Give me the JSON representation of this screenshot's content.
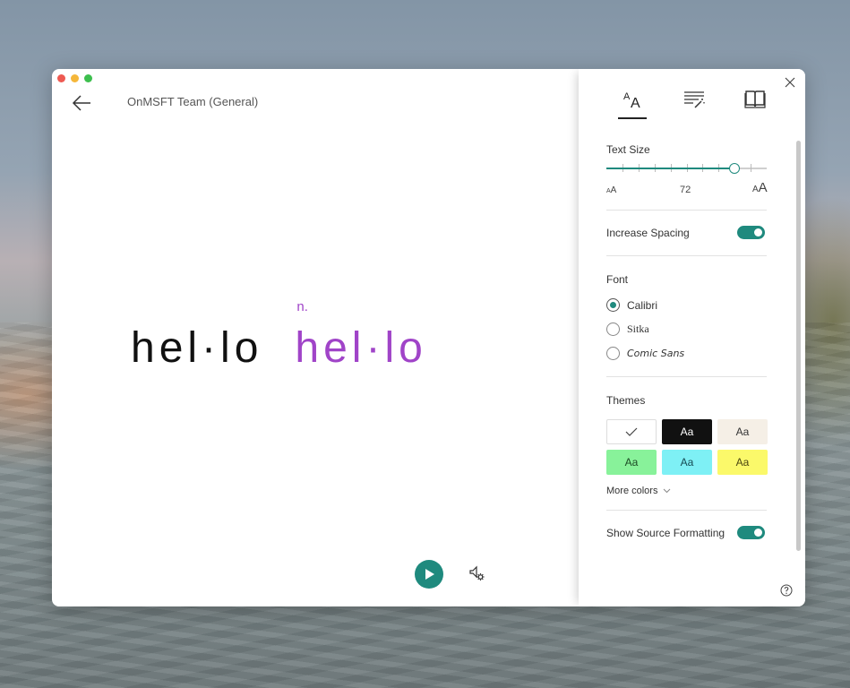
{
  "window": {
    "title": "OnMSFT Team (General)",
    "traffic_lights": [
      "close",
      "minimize",
      "maximize"
    ]
  },
  "reader": {
    "word": "hel·lo",
    "word_highlighted": "hel·lo",
    "part_of_speech": "n.",
    "highlight_color": "#a044c8",
    "play_label": "Play",
    "voice_settings_label": "Voice settings"
  },
  "panel": {
    "tabs": [
      {
        "name": "Text Preferences",
        "icon": "text-size-icon",
        "active": true
      },
      {
        "name": "Grammar Options",
        "icon": "grammar-wand-icon",
        "active": false
      },
      {
        "name": "Reading Preferences",
        "icon": "book-icon",
        "active": false
      }
    ],
    "text_size": {
      "label": "Text Size",
      "value": "72",
      "min_label": "AA",
      "max_label": "AA",
      "fraction": 0.8,
      "tick_count": 9
    },
    "increase_spacing": {
      "label": "Increase Spacing",
      "on": true
    },
    "font": {
      "label": "Font",
      "options": [
        {
          "label": "Calibri",
          "selected": true
        },
        {
          "label": "Sitka",
          "selected": false
        },
        {
          "label": "Comic Sans",
          "selected": false
        }
      ]
    },
    "themes": {
      "label": "Themes",
      "swatches": [
        {
          "label": "",
          "bg": "#ffffff",
          "fg": "#333333",
          "selected": true
        },
        {
          "label": "Aa",
          "bg": "#111111",
          "fg": "#ffffff",
          "selected": false
        },
        {
          "label": "Aa",
          "bg": "#f5efe6",
          "fg": "#333333",
          "selected": false
        },
        {
          "label": "Aa",
          "bg": "#88f29a",
          "fg": "#1c4a24",
          "selected": false
        },
        {
          "label": "Aa",
          "bg": "#7ef0f5",
          "fg": "#154a52",
          "selected": false
        },
        {
          "label": "Aa",
          "bg": "#fbf96a",
          "fg": "#4a4510",
          "selected": false
        }
      ],
      "more_colors": "More colors"
    },
    "show_source_formatting": {
      "label": "Show Source Formatting",
      "on": true
    },
    "accent_color": "#1f8a7e"
  }
}
